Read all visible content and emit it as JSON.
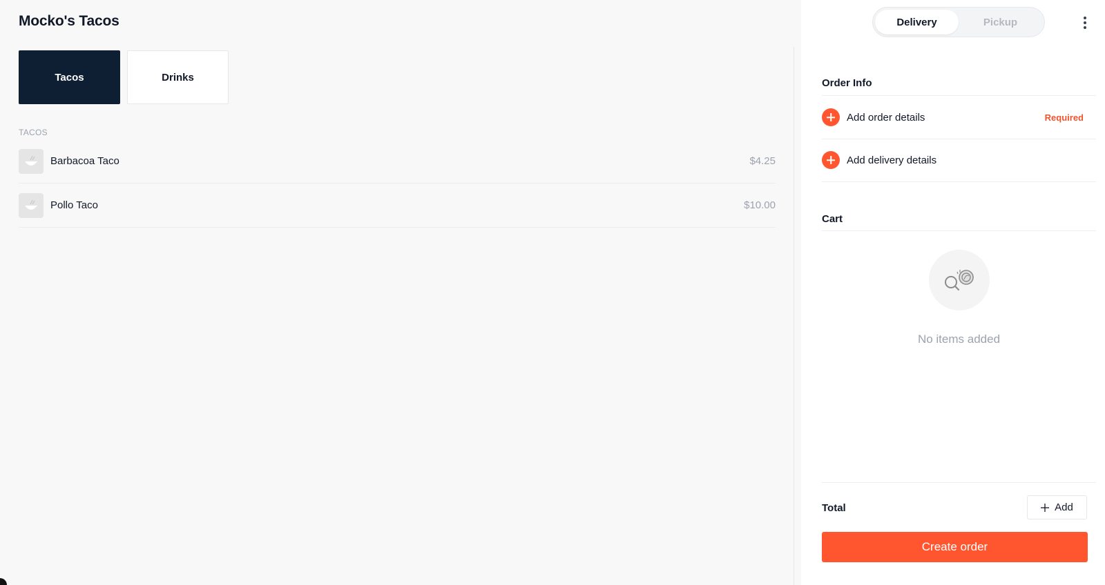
{
  "store": {
    "title": "Mocko's Tacos"
  },
  "categories": [
    {
      "label": "Tacos",
      "active": true
    },
    {
      "label": "Drinks",
      "active": false
    }
  ],
  "menu": {
    "section_label": "TACOS",
    "items": [
      {
        "name": "Barbacoa Taco",
        "price": "$4.25",
        "icon": "bowl-icon"
      },
      {
        "name": "Pollo Taco",
        "price": "$10.00",
        "icon": "bowl-icon"
      }
    ]
  },
  "order_panel": {
    "mode_toggle": {
      "options": [
        "Delivery",
        "Pickup"
      ],
      "selected": "Delivery"
    },
    "more_icon": "more-vertical-icon",
    "order_info": {
      "heading": "Order Info",
      "rows": [
        {
          "label": "Add order details",
          "badge": "Required"
        },
        {
          "label": "Add delivery details",
          "badge": ""
        }
      ]
    },
    "cart": {
      "heading": "Cart",
      "empty_text": "No items added",
      "empty_icon": "empty-cart-icon"
    },
    "total": {
      "label": "Total",
      "add_label": "Add"
    },
    "create_order_label": "Create order"
  },
  "colors": {
    "accent": "#ff5630",
    "required": "#f0532d",
    "active_tab": "#0f1f33",
    "muted_text": "#9ca3af",
    "main_bg": "#f8f8f8"
  }
}
